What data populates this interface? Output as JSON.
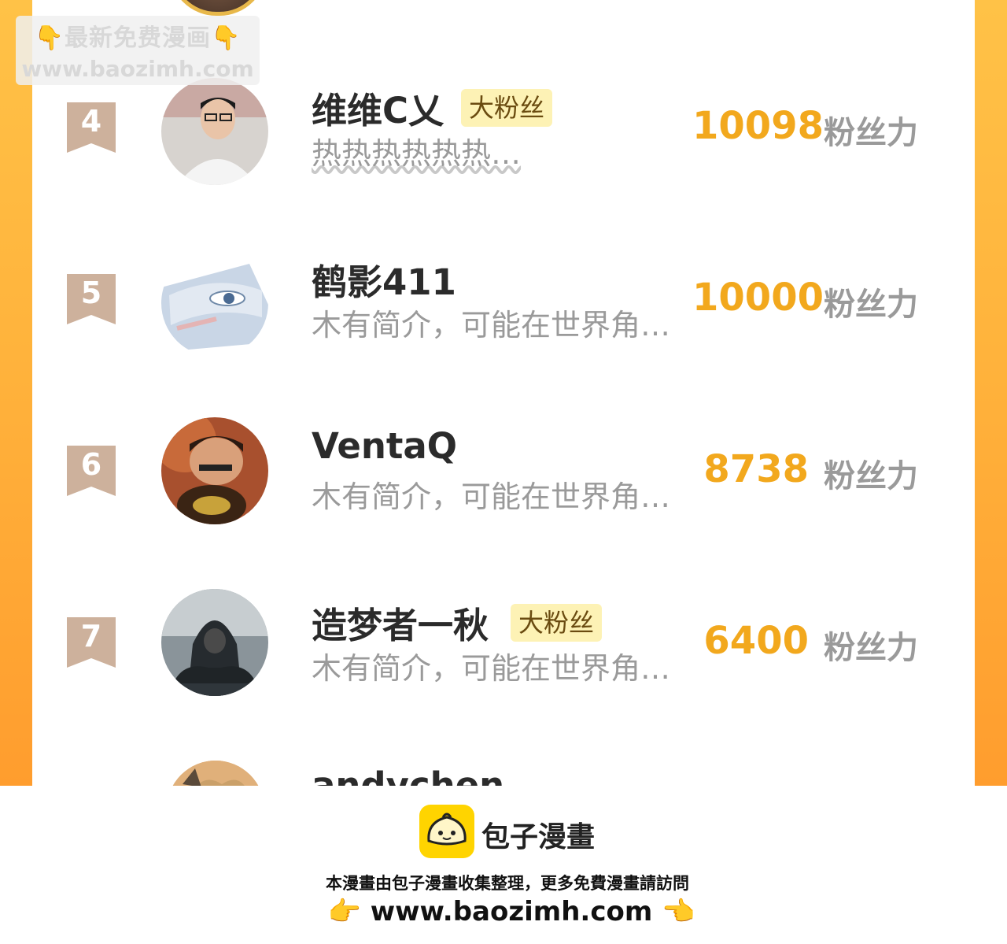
{
  "watermark": {
    "line1": "最新免费漫画",
    "line2": "www.baozimh.com",
    "hand_icon": "👇"
  },
  "ranking": [
    {
      "rank": "4",
      "name": "维维C乂",
      "tag": "大粉丝",
      "bio": "热热热热热热…",
      "score": "10098",
      "score_unit": "粉丝力"
    },
    {
      "rank": "5",
      "name": "鹤影411",
      "tag": "",
      "bio": "木有简介，可能在世界角…",
      "score": "10000",
      "score_unit": "粉丝力"
    },
    {
      "rank": "6",
      "name": "VentaQ",
      "tag": "",
      "bio": "木有简介，可能在世界角…",
      "score": "8738",
      "score_unit": "粉丝力"
    },
    {
      "rank": "7",
      "name": "造梦者一秋",
      "tag": "大粉丝",
      "bio": "木有简介，可能在世界角…",
      "score": "6400",
      "score_unit": "粉丝力"
    }
  ],
  "next_row": {
    "name_partial": "andychen"
  },
  "footer": {
    "brand": "包子漫畫",
    "note": "本漫畫由包子漫畫收集整理，更多免費漫畫請訪問",
    "url": "www.baozimh.com",
    "hand_left": "👉",
    "hand_right": "👈"
  },
  "colors": {
    "accent_orange": "#ffb33c",
    "score_gold": "#f2a81d",
    "rank_badge": "#cdb19c",
    "tag_bg": "#fdf2b5"
  }
}
